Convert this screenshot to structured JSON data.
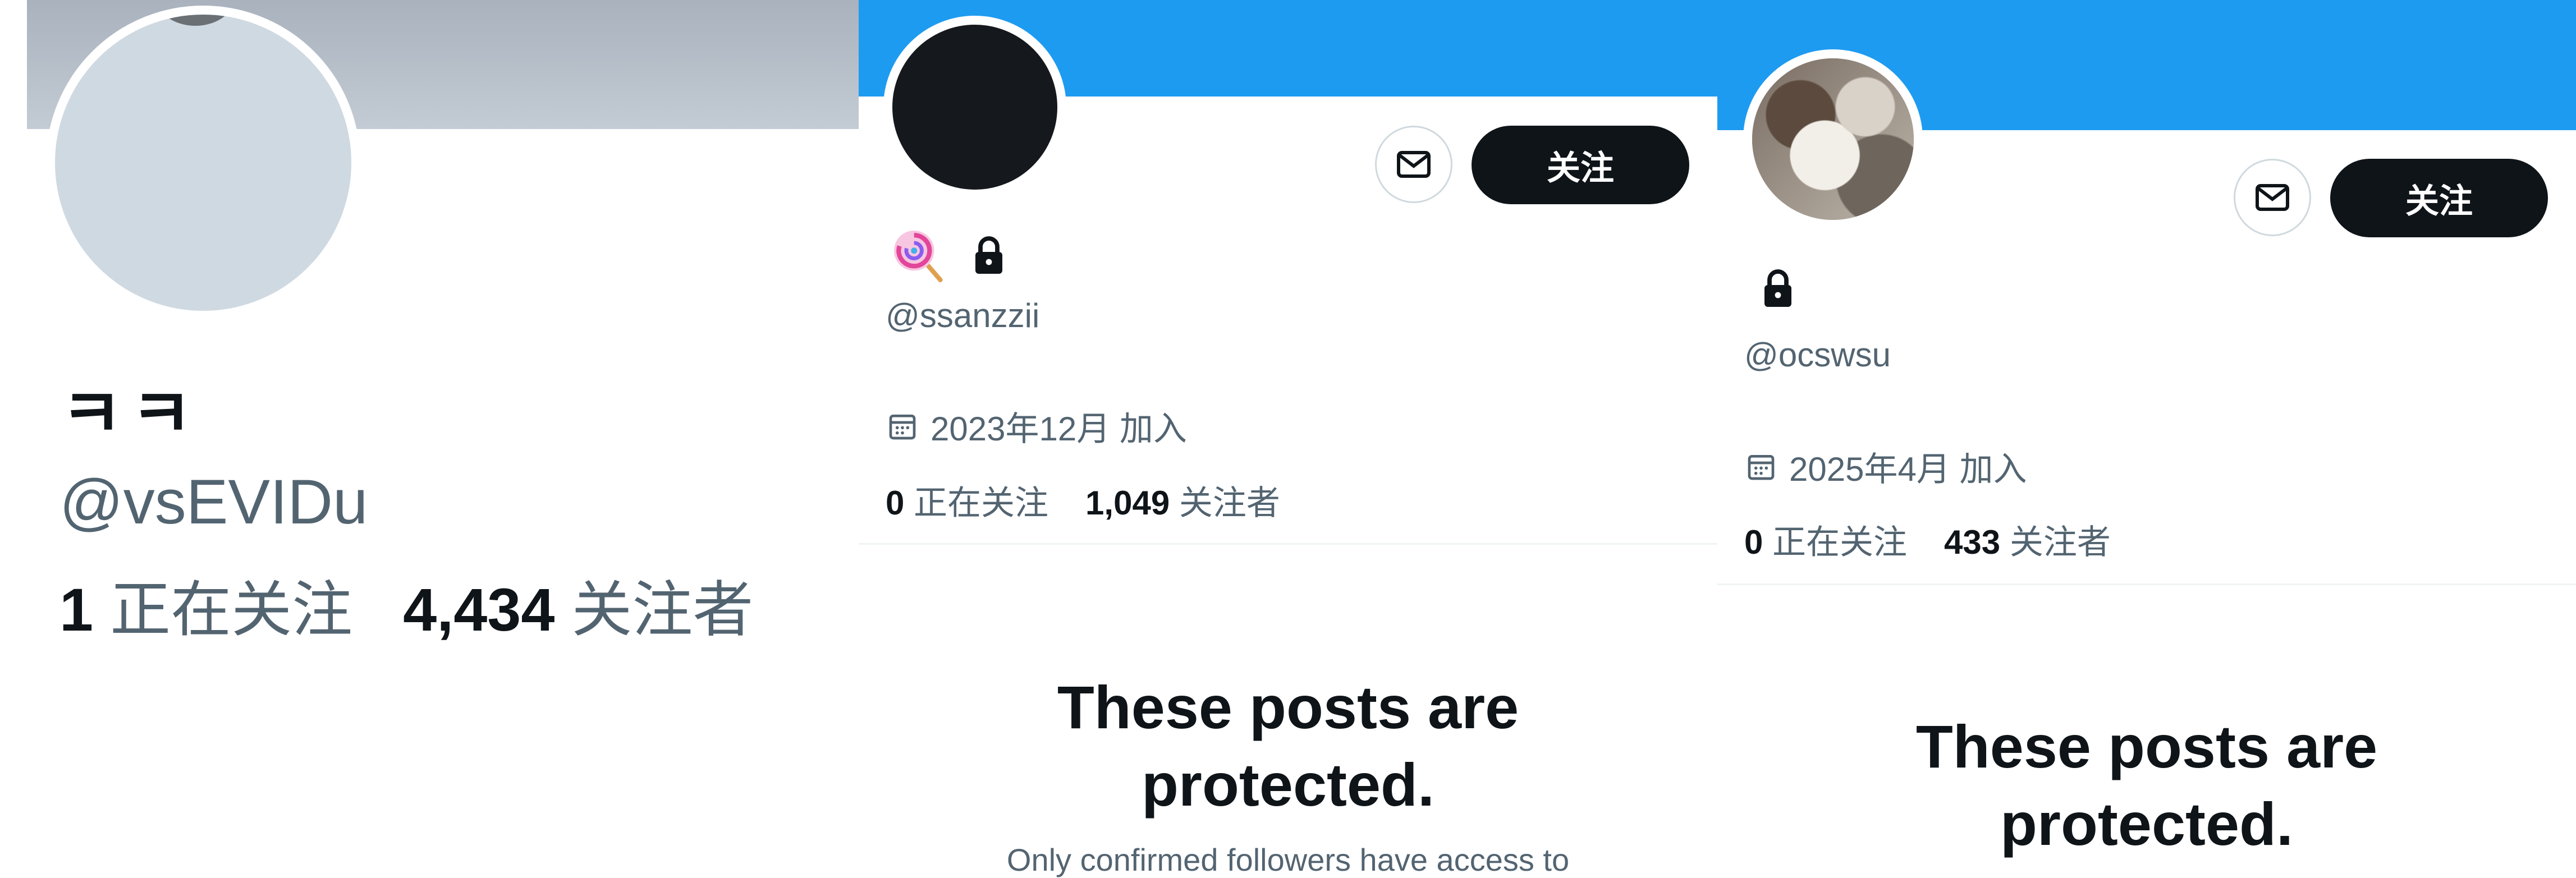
{
  "profile1": {
    "display_name": "ㅋㅋ",
    "handle": "@vsEVIDu",
    "following_count": "1",
    "following_label": "正在关注",
    "followers_count": "4,434",
    "followers_label": "关注者",
    "banner_color": "#b6bec8"
  },
  "profile2": {
    "badge_emoji": "🍭",
    "handle": "@ssanzzii",
    "joined": "2023年12月 加入",
    "following_count": "0",
    "following_label": "正在关注",
    "followers_count": "1,049",
    "followers_label": "关注者",
    "follow_button": "关注",
    "protected_title": "These posts are protected.",
    "protected_subtitle": "Only confirmed followers have access to",
    "banner_color": "#1d9bf0"
  },
  "profile3": {
    "handle": "@ocswsu",
    "joined": "2025年4月 加入",
    "following_count": "0",
    "following_label": "正在关注",
    "followers_count": "433",
    "followers_label": "关注者",
    "follow_button": "关注",
    "protected_title": "These posts are protected.",
    "banner_color": "#1d9bf0"
  },
  "icons": [
    "mail-icon",
    "lock-icon",
    "calendar-icon",
    "lollipop-icon"
  ]
}
